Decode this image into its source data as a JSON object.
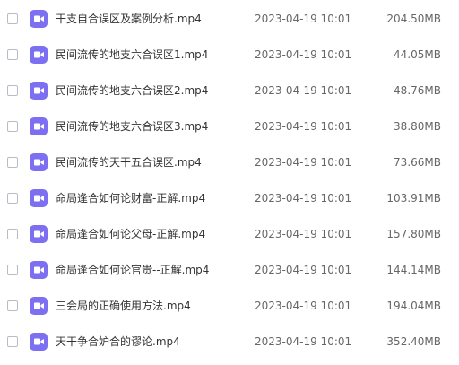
{
  "file_icon": "video-file-icon",
  "accent_color": "#7d6ff2",
  "files": [
    {
      "name": "干支自合误区及案例分析.mp4",
      "modified": "2023-04-19 10:01",
      "size": "204.50MB"
    },
    {
      "name": "民间流传的地支六合误区1.mp4",
      "modified": "2023-04-19 10:01",
      "size": "44.05MB"
    },
    {
      "name": "民间流传的地支六合误区2.mp4",
      "modified": "2023-04-19 10:01",
      "size": "48.76MB"
    },
    {
      "name": "民间流传的地支六合误区3.mp4",
      "modified": "2023-04-19 10:01",
      "size": "38.80MB"
    },
    {
      "name": "民间流传的天干五合误区.mp4",
      "modified": "2023-04-19 10:01",
      "size": "73.66MB"
    },
    {
      "name": "命局逢合如何论财富-正解.mp4",
      "modified": "2023-04-19 10:01",
      "size": "103.91MB"
    },
    {
      "name": "命局逢合如何论父母-正解.mp4",
      "modified": "2023-04-19 10:01",
      "size": "157.80MB"
    },
    {
      "name": "命局逢合如何论官贵--正解.mp4",
      "modified": "2023-04-19 10:01",
      "size": "144.14MB"
    },
    {
      "name": "三会局的正确使用方法.mp4",
      "modified": "2023-04-19 10:01",
      "size": "194.04MB"
    },
    {
      "name": "天干争合妒合的谬论.mp4",
      "modified": "2023-04-19 10:01",
      "size": "352.40MB"
    }
  ]
}
